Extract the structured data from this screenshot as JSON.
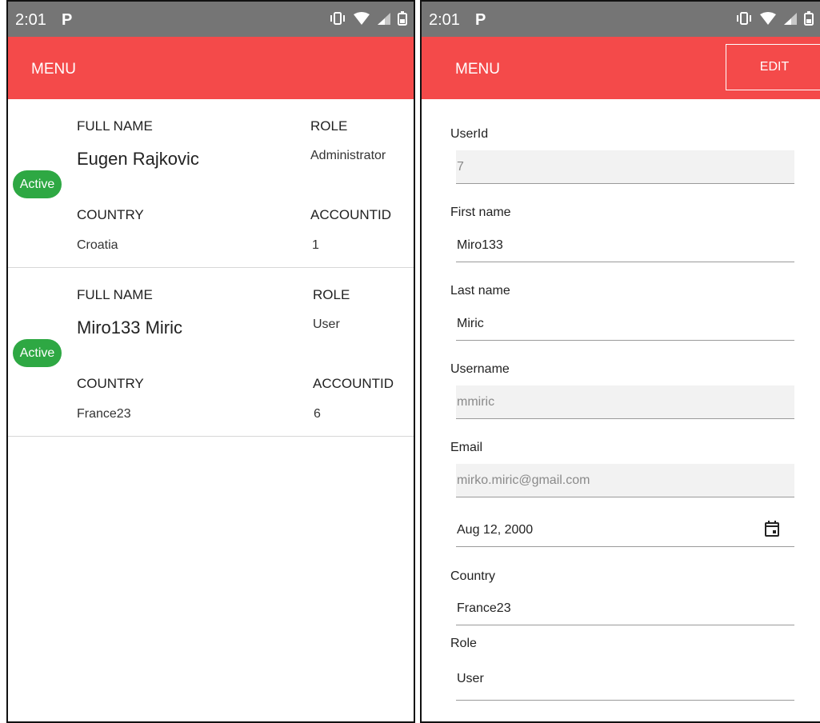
{
  "status_bar": {
    "time": "2:01",
    "notification_letter": "P"
  },
  "left_screen": {
    "menu_label": "MENU",
    "labels": {
      "full_name": "FULL NAME",
      "role": "ROLE",
      "country": "COUNTRY",
      "account_id": "ACCOUNTID"
    },
    "users": [
      {
        "full_name": "Eugen Rajkovic",
        "role": "Administrator",
        "country": "Croatia",
        "account_id": "1",
        "status": "Active"
      },
      {
        "full_name": "Miro133 Miric",
        "role": "User",
        "country": "France23",
        "account_id": "6",
        "status": "Active"
      }
    ]
  },
  "right_screen": {
    "menu_label": "MENU",
    "edit_label": "EDIT",
    "fields": {
      "user_id": {
        "label": "UserId",
        "value": "7"
      },
      "first_name": {
        "label": "First name",
        "value": "Miro133"
      },
      "last_name": {
        "label": "Last name",
        "value": "Miric"
      },
      "username": {
        "label": "Username",
        "value": "mmiric"
      },
      "email": {
        "label": "Email",
        "value": "mirko.miric@gmail.com"
      },
      "birth_date": {
        "value": "Aug 12, 2000"
      },
      "country": {
        "label": "Country",
        "value": "France23"
      },
      "role": {
        "label": "Role",
        "value": "User"
      }
    }
  },
  "colors": {
    "app_bar": "#f44a4a",
    "status_bar": "#757575",
    "active_badge": "#2ea843",
    "readonly_field_bg": "#f2f2f2"
  }
}
